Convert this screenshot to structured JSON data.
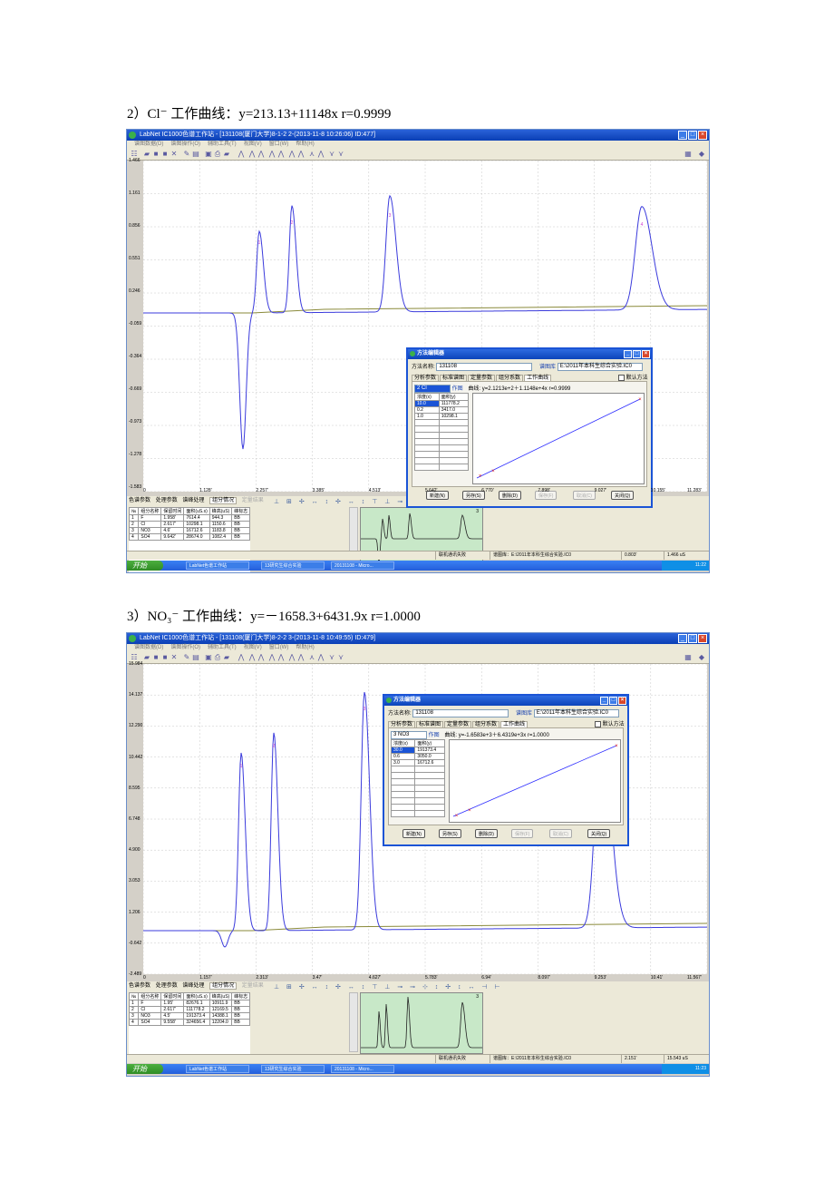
{
  "captions": {
    "c2": "2）Cl⁻ 工作曲线：y=213.13+11148x    r=0.9999",
    "c3": "3）NO₃⁻ 工作曲线：y=－1658.3+6431.9x    r=1.0000"
  },
  "shot1": {
    "window_title": "LabNet IC1000色谱工作站 - [131108(厦门大学)8-1-2 2-(2013-11-8 10:26:06) ID:477]",
    "y_ticks": [
      "1.466",
      "1.161",
      "0.856",
      "0.551",
      "0.246",
      "-0.059",
      "-0.364",
      "-0.669",
      "-0.973",
      "-1.278",
      "-1.583"
    ],
    "x_ticks": [
      "0",
      "1.128'",
      "2.257'",
      "3.385'",
      "4.513'",
      "5.642'",
      "6.770'",
      "7.898'",
      "9.027'",
      "10.155'",
      "11.283'"
    ],
    "peak_labels": [
      "1",
      "2",
      "3",
      "4"
    ],
    "table_headers": [
      "№",
      "组分名称",
      "保留时间",
      "面积(uS.s)",
      "峰高(uS)",
      "峰标志"
    ],
    "table_rows": [
      [
        "1",
        "F",
        "1.958'",
        "7614.4",
        "944.3",
        "BB"
      ],
      [
        "2",
        "Cl",
        "2.617'",
        "10298.1",
        "1150.6",
        "BB"
      ],
      [
        "3",
        "NO3",
        "4.6'",
        "16712.6",
        "1183.8",
        "BB"
      ],
      [
        "4",
        "SO4",
        "9.642'",
        "28674.0",
        "1082.4",
        "BB"
      ]
    ],
    "mini_label": "3",
    "status": [
      "联机通讯失败",
      "谱图库：E:\\2011年本科生综合实验.IC0",
      "0.803'",
      "1.466 uS"
    ],
    "clock": "11:22",
    "dialog": {
      "title": "方法编辑器",
      "method_label": "方法名称:",
      "method_value": "131108",
      "library_label": "谱图库",
      "library_value": "E:\\2011年本科生综合实验.IC0",
      "tabs": [
        "分析参数",
        "标准谱图",
        "定量参数",
        "组分系数",
        "工作曲线"
      ],
      "default_method": "默认方法",
      "component_select": "2   Cl",
      "plot_link": "作图",
      "curve_text": "曲线: y=2.1213e+2＋1.1148e+4x  r=0.9999",
      "cal_headers": [
        "浓度(x)",
        "面积(y)"
      ],
      "cal_rows": [
        [
          "10.0",
          "111778.2"
        ],
        [
          "0.2",
          "3417.0"
        ],
        [
          "1.0",
          "10298.1"
        ]
      ],
      "cal_points": [
        {
          "x": 0.2,
          "y": 3417.0
        },
        {
          "x": 1.0,
          "y": 10298.1
        },
        {
          "x": 10.0,
          "y": 111778.2
        }
      ],
      "buttons": [
        "新建(N)",
        "另存(S)",
        "删除(D)",
        "保存(F)",
        "取消(C)",
        "关闭(Q)"
      ]
    }
  },
  "shot2": {
    "window_title": "LabNet IC1000色谱工作站 - [131108(厦门大学)8-2-2 3-(2013-11-8 10:49:55) ID:479]",
    "y_ticks": [
      "15.984",
      "14.137",
      "12.290",
      "10.442",
      "8.595",
      "6.748",
      "4.900",
      "3.053",
      "1.206",
      "-0.642",
      "-2.489"
    ],
    "x_ticks": [
      "0",
      "1.157'",
      "2.313'",
      "3.47'",
      "4.627'",
      "5.783'",
      "6.94'",
      "8.097'",
      "9.253'",
      "10.41'",
      "11.567'"
    ],
    "peak_labels": [
      "1",
      "2",
      "3"
    ],
    "table_headers": [
      "№",
      "组分名称",
      "保留时间",
      "面积(uS.s)",
      "峰高(uS)",
      "峰标志"
    ],
    "table_rows": [
      [
        "1",
        "F",
        "1.95'",
        "82676.1",
        "10911.9",
        "BB"
      ],
      [
        "2",
        "Cl",
        "2.617'",
        "111778.2",
        "12169.5",
        "BB"
      ],
      [
        "3",
        "NO3",
        "4.5'",
        "191373.4",
        "14388.1",
        "BB"
      ],
      [
        "4",
        "SO4",
        "9.558'",
        "324656.4",
        "12204.0",
        "BB"
      ]
    ],
    "mini_label": "3",
    "status": [
      "联机通讯失败",
      "谱图库：E:\\2011年本科生综合实验.IC0",
      "2.151'",
      "15.543 uS"
    ],
    "clock": "11:23",
    "dialog": {
      "title": "方法编辑器",
      "method_label": "方法名称:",
      "method_value": "131108",
      "library_label": "谱图库",
      "library_value": "E:\\2011年本科生综合实验.IC0",
      "tabs": [
        "分析参数",
        "标准谱图",
        "定量参数",
        "组分系数",
        "工作曲线"
      ],
      "default_method": "默认方法",
      "component_select": "3   NO3",
      "plot_link": "作图",
      "curve_text": "曲线: y=-1.6583e+3＋6.4319e+3x  r=1.0000",
      "cal_headers": [
        "浓度(x)",
        "面积(y)"
      ],
      "cal_rows": [
        [
          "30.0",
          "191373.4"
        ],
        [
          "0.6",
          "3050.0"
        ],
        [
          "3.0",
          "16712.6"
        ]
      ],
      "cal_points": [
        {
          "x": 0.6,
          "y": 3050.0
        },
        {
          "x": 3.0,
          "y": 16712.6
        },
        {
          "x": 30.0,
          "y": 191373.4
        }
      ],
      "buttons": [
        "新建(N)",
        "另存(S)",
        "删除(D)",
        "保存(F)",
        "取消(C)",
        "关闭(Q)"
      ]
    }
  },
  "common": {
    "menu": [
      "谱图数据(D)",
      "谱图操作(O)",
      "辅助工具(T)",
      "视图(V)",
      "窗口(W)",
      "帮助(H)"
    ],
    "bottom_tabs": [
      "色谱参数",
      "处理参数",
      "谱峰处理",
      "组分情况",
      "定量结果"
    ],
    "start": "开始",
    "tasks": [
      "LabNet色谱工作站",
      "13研究生综合实验",
      "20131108 - Micro..."
    ]
  },
  "colors": {
    "trace": "#3b3bdc",
    "baseline": "#8a8a3a",
    "peak_label": "#d03cd0",
    "grid": "#c8c8c8",
    "mini_bg": "#c8e8c8"
  }
}
